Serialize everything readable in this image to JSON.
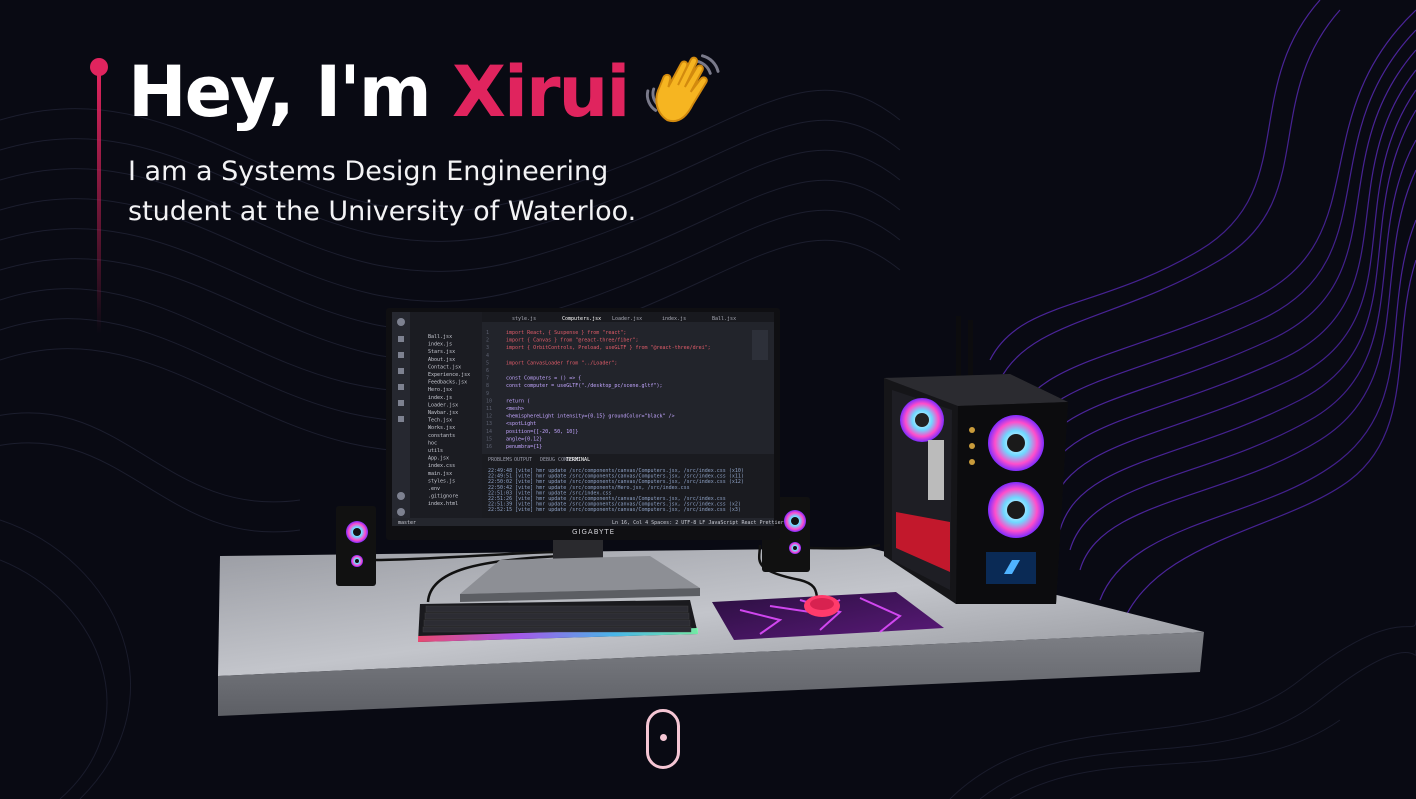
{
  "hero": {
    "greeting": "Hey, I'm ",
    "name": "Xirui",
    "wave_icon": "waving-hand-icon",
    "subtitle_line1": "I am a Systems Design Engineering",
    "subtitle_line2": "student at the University of Waterloo."
  },
  "monitor": {
    "brand": "GIGABYTE",
    "tabs": [
      "style.js",
      "Computers.jsx",
      "Loader.jsx",
      "index.js",
      "Ball.jsx"
    ],
    "sidebar_files": [
      "Ball.jsx",
      "index.js",
      "Stars.jsx",
      "About.jsx",
      "Contact.jsx",
      "Experience.jsx",
      "Feedbacks.jsx",
      "Hero.jsx",
      "index.js",
      "Loader.jsx",
      "Navbar.jsx",
      "Tech.jsx",
      "Works.jsx",
      "constants",
      "hoc",
      "utils",
      "App.jsx",
      "index.css",
      "main.jsx",
      "styles.js",
      ".env",
      ".gitignore",
      "index.html"
    ],
    "code_lines": [
      "import React, { Suspense } from \"react\";",
      "import { Canvas } from \"@react-three/fiber\";",
      "import { OrbitControls, Preload, useGLTF } from \"@react-three/drei\";",
      "",
      "import CanvasLoader from \"../Loader\";",
      "",
      "const Computers = () => {",
      "  const computer = useGLTF(\"./desktop_pc/scene.gltf\");",
      "",
      "  return (",
      "    <mesh>",
      "      <hemisphereLight intensity={0.15} groundColor=\"black\" />",
      "      <spotLight",
      "        position={[-20, 50, 10]}",
      "        angle={0.12}",
      "        penumbra={1}"
    ],
    "panel_tabs": [
      "PROBLEMS",
      "OUTPUT",
      "DEBUG CONSOLE",
      "TERMINAL"
    ],
    "terminal_lines": [
      "22:49:48 [vite] hmr update /src/components/canvas/Computers.jsx, /src/index.css (x10)",
      "22:49:51 [vite] hmr update /src/components/canvas/Computers.jsx, /src/index.css (x11)",
      "22:50:02 [vite] hmr update /src/components/canvas/Computers.jsx, /src/index.css (x12)",
      "22:50:42 [vite] hmr update /src/components/Hero.jsx, /src/index.css",
      "22:51:03 [vite] hmr update /src/index.css",
      "22:51:26 [vite] hmr update /src/components/canvas/Computers.jsx, /src/index.css",
      "22:51:39 [vite] hmr update /src/components/canvas/Computers.jsx, /src/index.css (x2)",
      "22:52:15 [vite] hmr update /src/components/canvas/Computers.jsx, /src/index.css (x3)"
    ],
    "status_left": "master",
    "status_right": "Ln 16, Col 4   Spaces: 2   UTF-8   LF   JavaScript React   Prettier"
  },
  "scroll_icon": "mouse-scroll-icon",
  "colors": {
    "accent": "#e0245e",
    "background": "#090a13",
    "subtitle": "#f3f3f5",
    "scroll": "#f5c6d4"
  }
}
